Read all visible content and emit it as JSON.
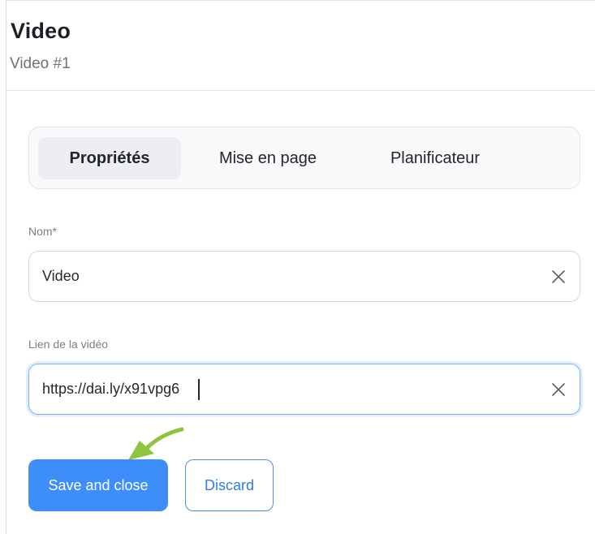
{
  "header": {
    "title": "Video",
    "subtitle": "Video #1"
  },
  "tabs": [
    {
      "label": "Propriétés",
      "active": true
    },
    {
      "label": "Mise en page",
      "active": false
    },
    {
      "label": "Planificateur",
      "active": false
    }
  ],
  "fields": {
    "name": {
      "label": "Nom*",
      "value": "Video"
    },
    "video_link": {
      "label": "Lien de la vidéo",
      "value": "https://dai.ly/x91vpg6"
    }
  },
  "actions": {
    "save_label": "Save and close",
    "discard_label": "Discard"
  },
  "icons": {
    "clear": "close-icon",
    "annotation": "arrow-icon"
  },
  "colors": {
    "primary": "#3d8ef8",
    "annotation_arrow": "#8cc63f"
  }
}
